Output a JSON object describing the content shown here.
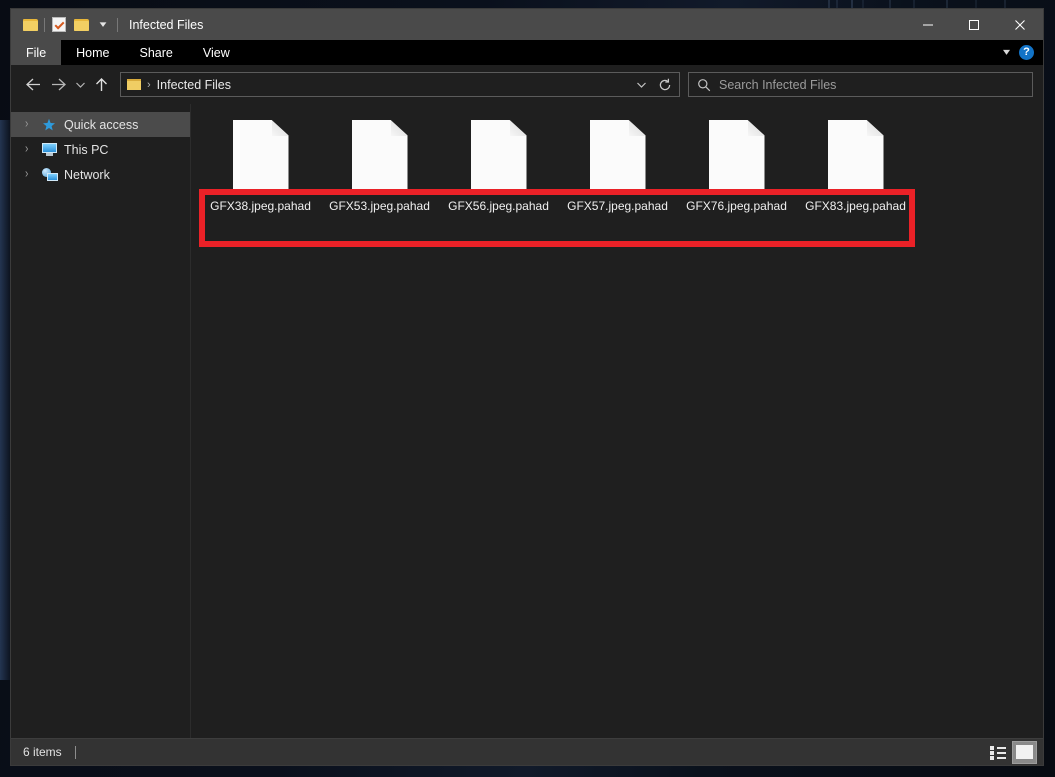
{
  "window": {
    "title": "Infected Files",
    "quick_access_toolbar": [
      {
        "name": "folder-properties-icon",
        "label": "Folder"
      },
      {
        "name": "properties-icon",
        "label": "Properties"
      },
      {
        "name": "new-folder-icon",
        "label": "New folder"
      },
      {
        "name": "customize-chevron-icon",
        "label": "⌄"
      }
    ],
    "controls": {
      "minimize": "─",
      "maximize": "☐",
      "close": "✕"
    }
  },
  "ribbon": {
    "tabs": [
      {
        "label": "File",
        "active": true
      },
      {
        "label": "Home",
        "active": false
      },
      {
        "label": "Share",
        "active": false
      },
      {
        "label": "View",
        "active": false
      }
    ],
    "expand_icon": "⌄",
    "help_label": "?"
  },
  "navigation": {
    "back_tooltip": "Back",
    "forward_tooltip": "Forward",
    "recent_tooltip": "Recent locations",
    "up_tooltip": "Up",
    "breadcrumb": {
      "separator": "›",
      "items": [
        "Infected Files"
      ]
    },
    "address_dropdown": "⌄",
    "refresh": "↻"
  },
  "search": {
    "placeholder": "Search Infected Files",
    "value": ""
  },
  "sidebar": {
    "items": [
      {
        "label": "Quick access",
        "icon": "pin-star-icon",
        "selected": true,
        "expander": "›"
      },
      {
        "label": "This PC",
        "icon": "computer-icon",
        "selected": false,
        "expander": "›"
      },
      {
        "label": "Network",
        "icon": "network-icon",
        "selected": false,
        "expander": "›"
      }
    ]
  },
  "files": [
    {
      "name": "GFX38.jpeg.pahad",
      "icon": "generic-file-icon"
    },
    {
      "name": "GFX53.jpeg.pahad",
      "icon": "generic-file-icon"
    },
    {
      "name": "GFX56.jpeg.pahad",
      "icon": "generic-file-icon"
    },
    {
      "name": "GFX57.jpeg.pahad",
      "icon": "generic-file-icon"
    },
    {
      "name": "GFX76.jpeg.pahad",
      "icon": "generic-file-icon"
    },
    {
      "name": "GFX83.jpeg.pahad",
      "icon": "generic-file-icon"
    }
  ],
  "annotation": {
    "color": "#ea2127",
    "shape": "rectangle",
    "target": "file name labels row"
  },
  "statusbar": {
    "item_count": "6 items",
    "views": [
      {
        "name": "details-view-button",
        "active": false
      },
      {
        "name": "large-icons-view-button",
        "active": true
      }
    ]
  },
  "colors": {
    "window_background": "#1f1f1f",
    "titlebar": "#4a4a4a",
    "ribbon": "#000000",
    "statusbar": "#333333",
    "selection": "#4b4b4b",
    "accent_help": "#1273c7",
    "annotation_red": "#ea2127"
  }
}
